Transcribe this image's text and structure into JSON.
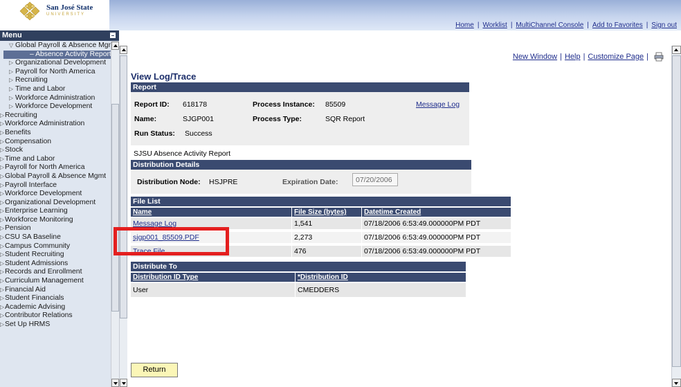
{
  "banner": {
    "logo_name": "San José State",
    "logo_sub": "UNIVERSITY",
    "links": [
      "Home",
      "Worklist",
      "MultiChannel Console",
      "Add to Favorites",
      "Sign out"
    ]
  },
  "menu": {
    "title": "Menu",
    "items": [
      {
        "label": "Global Payroll & Absence Mgmt",
        "level": 1,
        "expanded": true
      },
      {
        "label": "Absence Activity Report",
        "level": 2,
        "selected": true
      },
      {
        "label": "Organizational Development",
        "level": 1
      },
      {
        "label": "Payroll for North America",
        "level": 1
      },
      {
        "label": "Recruiting",
        "level": 1
      },
      {
        "label": "Time and Labor",
        "level": 1
      },
      {
        "label": "Workforce Administration",
        "level": 1
      },
      {
        "label": "Workforce Development",
        "level": 1
      },
      {
        "label": "Recruiting",
        "level": 0
      },
      {
        "label": "Workforce Administration",
        "level": 0
      },
      {
        "label": "Benefits",
        "level": 0
      },
      {
        "label": "Compensation",
        "level": 0
      },
      {
        "label": "Stock",
        "level": 0
      },
      {
        "label": "Time and Labor",
        "level": 0
      },
      {
        "label": "Payroll for North America",
        "level": 0
      },
      {
        "label": "Global Payroll & Absence Mgmt",
        "level": 0
      },
      {
        "label": "Payroll Interface",
        "level": 0
      },
      {
        "label": "Workforce Development",
        "level": 0
      },
      {
        "label": "Organizational Development",
        "level": 0
      },
      {
        "label": "Enterprise Learning",
        "level": 0
      },
      {
        "label": "Workforce Monitoring",
        "level": 0
      },
      {
        "label": "Pension",
        "level": 0
      },
      {
        "label": "CSU SA Baseline",
        "level": 0
      },
      {
        "label": "Campus Community",
        "level": 0
      },
      {
        "label": "Student Recruiting",
        "level": 0
      },
      {
        "label": "Student Admissions",
        "level": 0
      },
      {
        "label": "Records and Enrollment",
        "level": 0
      },
      {
        "label": "Curriculum Management",
        "level": 0
      },
      {
        "label": "Financial Aid",
        "level": 0
      },
      {
        "label": "Student Financials",
        "level": 0
      },
      {
        "label": "Academic Advising",
        "level": 0
      },
      {
        "label": "Contributor Relations",
        "level": 0
      },
      {
        "label": "Set Up HRMS",
        "level": 0
      }
    ]
  },
  "tools": {
    "new_window": "New Window",
    "help": "Help",
    "customize": "Customize Page",
    "print_icon": "print-icon"
  },
  "page": {
    "title": "View Log/Trace",
    "report_header": "Report",
    "report_id_label": "Report ID:",
    "report_id": "618178",
    "process_instance_label": "Process Instance:",
    "process_instance": "85509",
    "message_log": "Message Log",
    "name_label": "Name:",
    "name": "SJGP001",
    "process_type_label": "Process Type:",
    "process_type": "SQR Report",
    "run_status_label": "Run Status:",
    "run_status": "Success",
    "report_description": "SJSU Absence Activity Report",
    "distribution_details_header": "Distribution Details",
    "distribution_node_label": "Distribution Node:",
    "distribution_node": "HSJPRE",
    "expiration_date_label": "Expiration Date:",
    "expiration_date": "07/20/2006",
    "file_list_header": "File List",
    "file_columns": [
      "Name",
      "File Size (bytes)",
      "Datetime Created"
    ],
    "files": [
      {
        "name": "Message Log",
        "size": "1,541",
        "created": "07/18/2006  6:53:49.000000PM PDT"
      },
      {
        "name": "sjgp001_85509.PDF",
        "size": "2,273",
        "created": "07/18/2006  6:53:49.000000PM PDT"
      },
      {
        "name": "Trace File",
        "size": "476",
        "created": "07/18/2006  6:53:49.000000PM PDT"
      }
    ],
    "distribute_to_header": "Distribute To",
    "dist_columns": [
      "Distribution ID Type",
      "*Distribution ID"
    ],
    "distribution_rows": [
      {
        "type": "User",
        "id": "CMEDDERS"
      }
    ],
    "return_button": "Return"
  },
  "colors": {
    "section_header": "#3a4a70",
    "menu_header": "#30405e",
    "link": "#1f2d8c",
    "highlight_box": "#e41f1f",
    "return_button": "#fbf6b7"
  }
}
